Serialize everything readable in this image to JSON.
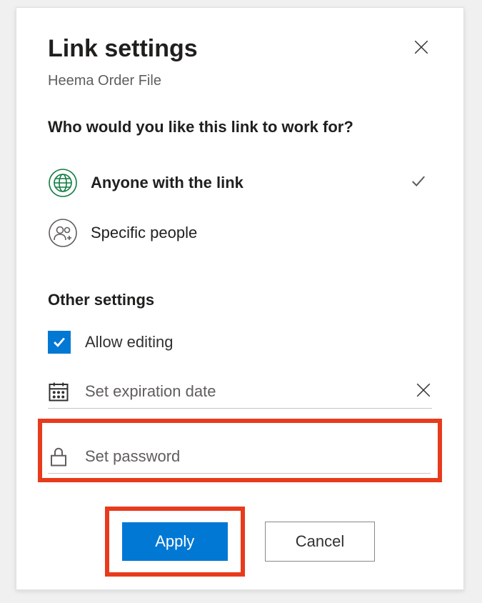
{
  "header": {
    "title": "Link settings",
    "subtitle": "Heema Order File"
  },
  "prompt": "Who would you like this link to work for?",
  "options": {
    "anyone": "Anyone with the link",
    "specific": "Specific people"
  },
  "other": {
    "header": "Other settings",
    "allow_editing": "Allow editing",
    "expiration_placeholder": "Set expiration date",
    "password_placeholder": "Set password"
  },
  "buttons": {
    "apply": "Apply",
    "cancel": "Cancel"
  }
}
